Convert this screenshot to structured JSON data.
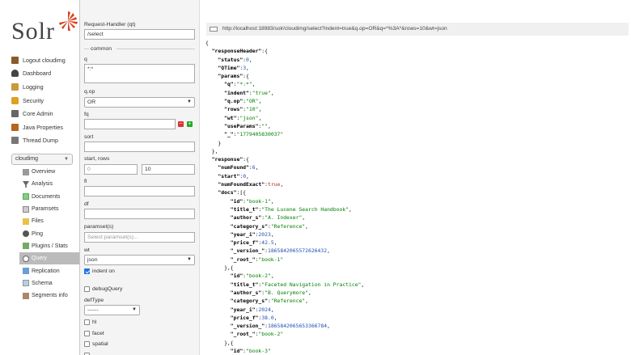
{
  "app": {
    "logo_text": "Solr"
  },
  "nav": {
    "items": [
      {
        "label": "Logout cloudimg",
        "icon": "logout-icon"
      },
      {
        "label": "Dashboard",
        "icon": "dashboard-icon"
      },
      {
        "label": "Logging",
        "icon": "logging-icon"
      },
      {
        "label": "Security",
        "icon": "security-icon"
      },
      {
        "label": "Core Admin",
        "icon": "core-admin-icon"
      },
      {
        "label": "Java Properties",
        "icon": "java-properties-icon"
      },
      {
        "label": "Thread Dump",
        "icon": "thread-dump-icon"
      }
    ],
    "core_selector": "cloudimg",
    "core_items": [
      {
        "label": "Overview",
        "icon": "home-icon"
      },
      {
        "label": "Analysis",
        "icon": "funnel-icon"
      },
      {
        "label": "Documents",
        "icon": "documents-icon"
      },
      {
        "label": "Paramsets",
        "icon": "paramsets-icon"
      },
      {
        "label": "Files",
        "icon": "folder-icon"
      },
      {
        "label": "Ping",
        "icon": "ping-icon"
      },
      {
        "label": "Plugins / Stats",
        "icon": "plugins-icon"
      },
      {
        "label": "Query",
        "icon": "search-icon"
      },
      {
        "label": "Replication",
        "icon": "replication-icon"
      },
      {
        "label": "Schema",
        "icon": "schema-icon"
      },
      {
        "label": "Segments info",
        "icon": "segments-icon"
      }
    ]
  },
  "form": {
    "handler_label": "Request-Handler (qt)",
    "handler_value": "/select",
    "common_legend": "common",
    "q_label": "q",
    "q_value": "*:*",
    "qop_label": "q.op",
    "qop_value": "OR",
    "fq_label": "fq",
    "sort_label": "sort",
    "start_rows_label": "start, rows",
    "start_placeholder": "0",
    "rows_value": "10",
    "fl_label": "fl",
    "df_label": "df",
    "paramsets_label": "paramset(s)",
    "paramsets_placeholder": "Select paramset(s)...",
    "wt_label": "wt",
    "wt_value": "json",
    "indent_label": "indent on",
    "debug_label": "debugQuery",
    "deftype_label": "defType",
    "deftype_value": "------",
    "hl_label": "hl",
    "facet_label": "facet",
    "spatial_label": "spatial"
  },
  "result": {
    "url": "http://localhost:18983/solr/cloudimg/select?indent=true&q.op=OR&q=*%3A*&rows=10&wt=json",
    "response_header": {
      "status": "0",
      "qtime": "3",
      "q": "\"*:*\"",
      "indent": "\"true\"",
      "qop": "\"OR\"",
      "rows": "\"10\"",
      "wt": "\"json\"",
      "useParams": "\"\"",
      "underscore": "\"1779405830037\""
    },
    "response": {
      "numFound": "6",
      "start": "0",
      "numFoundExact": "true"
    },
    "docs": [
      {
        "id": "\"book-1\"",
        "title_t": "\"The Lucene Search Handbook\"",
        "author_s": "\"A. Indexer\"",
        "category_s": "\"Reference\"",
        "year_i": "2023",
        "price_f": "42.5",
        "version": "1865842065572626432",
        "root": "\"book-1\""
      },
      {
        "id": "\"book-2\"",
        "title_t": "\"Faceted Navigation in Practice\"",
        "author_s": "\"B. Querymore\"",
        "category_s": "\"Reference\"",
        "year_i": "2024",
        "price_f": "38.0",
        "version": "1865842065653366784",
        "root": "\"book-2\""
      }
    ],
    "third_doc_id_partial": "\"book-3\""
  }
}
